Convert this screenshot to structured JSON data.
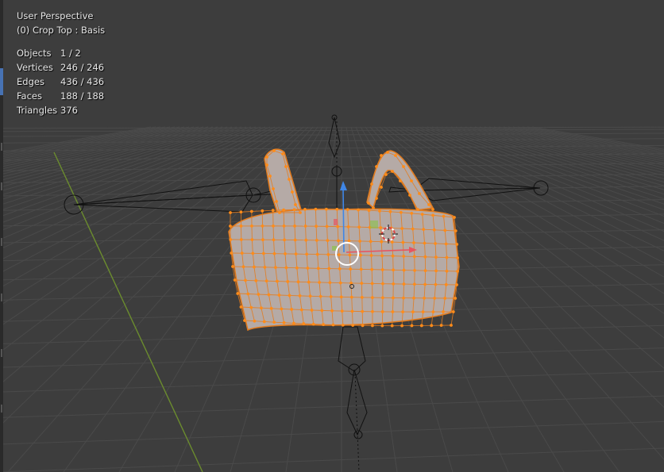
{
  "viewport": {
    "view_name": "User Perspective",
    "object_info": "(0) Crop Top : Basis"
  },
  "stats": [
    {
      "label": "Objects",
      "value": "1 / 2"
    },
    {
      "label": "Vertices",
      "value": "246 / 246"
    },
    {
      "label": "Edges",
      "value": "436 / 436"
    },
    {
      "label": "Faces",
      "value": "188 / 188"
    },
    {
      "label": "Triangles",
      "value": "376"
    }
  ],
  "colors": {
    "background": "#3d3d3d",
    "grid_line": "#4a4a4a",
    "y_axis": "#6b8c2e",
    "mesh_fill": "#b5aaa6",
    "mesh_edge": "#e27b1e",
    "selected_vertex": "#ff8c1a",
    "armature": "#111111",
    "gizmo_x": "#e8545f",
    "gizmo_y": "#8bc34a",
    "gizmo_z": "#3f86e6",
    "active_tab": "#4772b3"
  }
}
